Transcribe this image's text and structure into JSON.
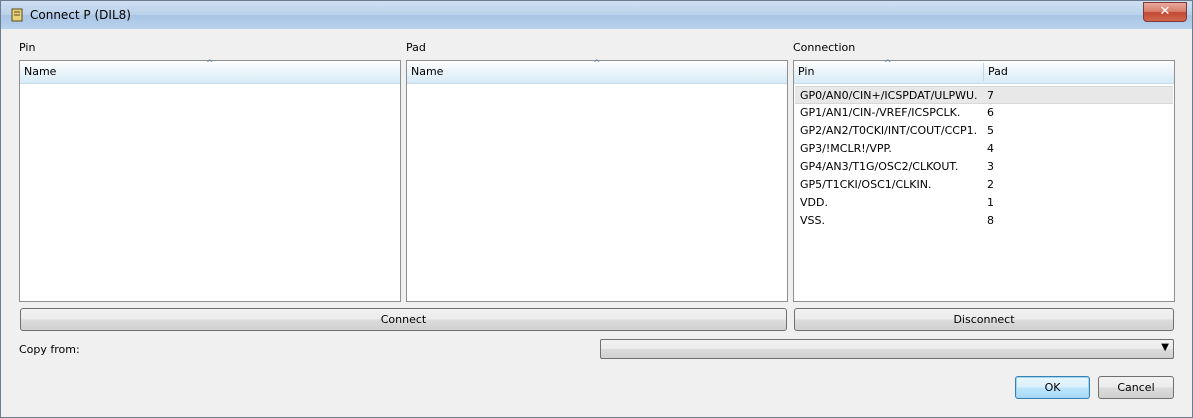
{
  "window": {
    "title": "Connect P (DIL8)",
    "close_label": "✕"
  },
  "pin_panel": {
    "label": "Pin",
    "header": "Name"
  },
  "pad_panel": {
    "label": "Pad",
    "header": "Name"
  },
  "connection_panel": {
    "label": "Connection",
    "columns": [
      "Pin",
      "Pad"
    ],
    "rows": [
      {
        "pin": "GP0/AN0/CIN+/ICSPDAT/ULPWU.",
        "pad": "7"
      },
      {
        "pin": "GP1/AN1/CIN-/VREF/ICSPCLK.",
        "pad": "6"
      },
      {
        "pin": "GP2/AN2/T0CKI/INT/COUT/CCP1.",
        "pad": "5"
      },
      {
        "pin": "GP3/!MCLR!/VPP.",
        "pad": "4"
      },
      {
        "pin": "GP4/AN3/T1G/OSC2/CLKOUT.",
        "pad": "3"
      },
      {
        "pin": "GP5/T1CKI/OSC1/CLKIN.",
        "pad": "2"
      },
      {
        "pin": "VDD.",
        "pad": "1"
      },
      {
        "pin": "VSS.",
        "pad": "8"
      }
    ]
  },
  "buttons": {
    "connect": "Connect",
    "disconnect": "Disconnect",
    "ok": "OK",
    "cancel": "Cancel"
  },
  "copy_from": {
    "label": "Copy from:",
    "value": ""
  },
  "icons": {
    "window": "book-icon",
    "sort": "sort-ascending-icon",
    "dropdown": "chevron-down-icon"
  }
}
